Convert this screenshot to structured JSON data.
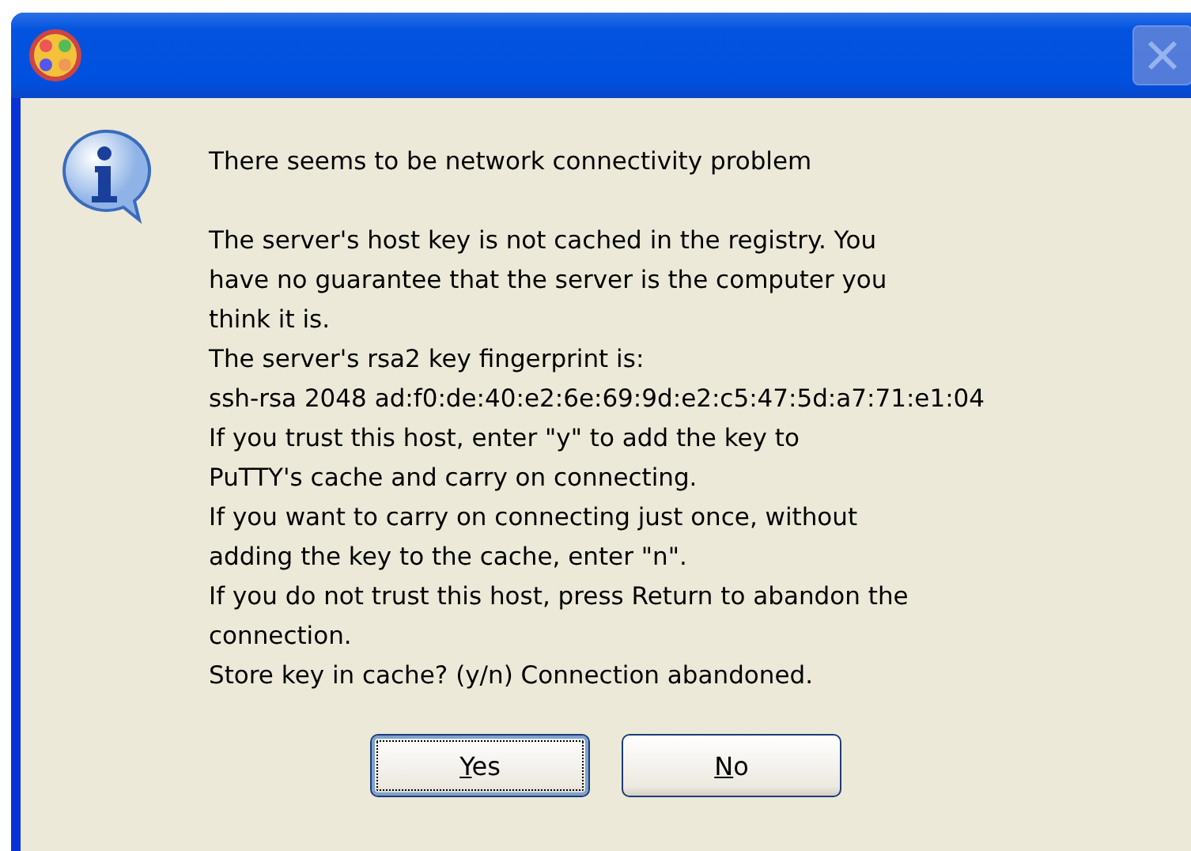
{
  "window": {
    "close_disabled": true
  },
  "heading": "There seems to be network connectivity problem",
  "message_lines": [
    "The server's host key is not cached in the registry. You",
    "have no guarantee that the server is the computer you",
    "think it is.",
    "The server's rsa2 key fingerprint is:",
    "ssh-rsa 2048 ad:f0:de:40:e2:6e:69:9d:e2:c5:47:5d:a7:71:e1:04",
    "If you trust this host, enter \"y\" to add the key to",
    "PuTTY's cache and carry on connecting.",
    "If you want to carry on connecting just once, without",
    "adding the key to the cache, enter \"n\".",
    "If you do not trust this host, press Return to abandon the",
    "connection.",
    "Store key in cache? (y/n) Connection abandoned."
  ],
  "buttons": [
    {
      "label": "Yes",
      "focused": true
    },
    {
      "label": "No",
      "focused": false
    }
  ]
}
